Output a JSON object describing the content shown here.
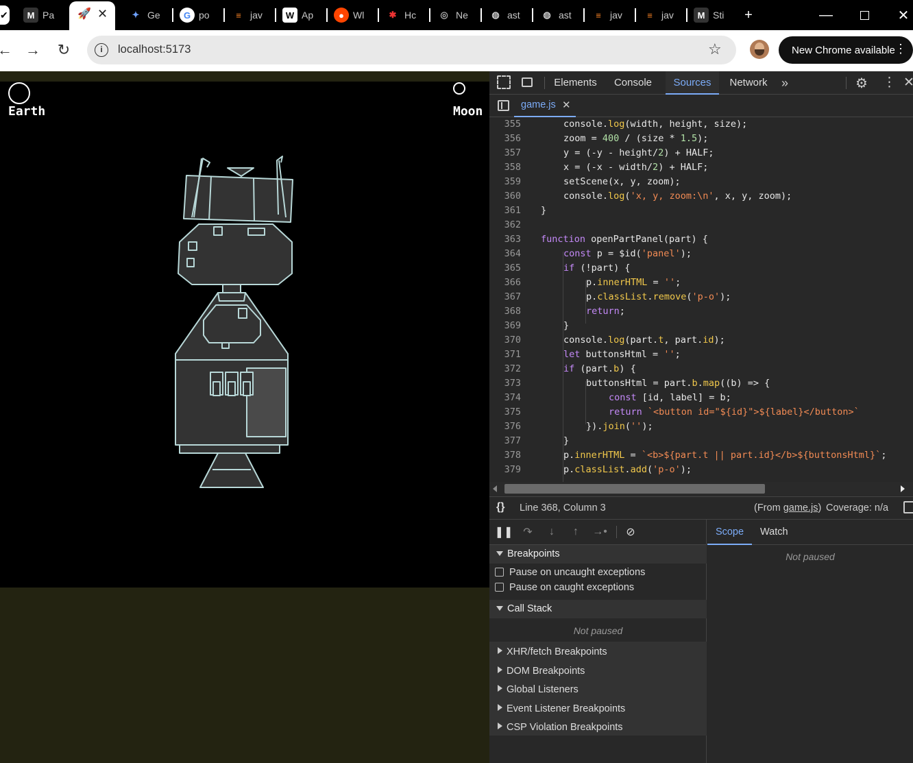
{
  "browser": {
    "tabs": [
      {
        "label": "Pa",
        "icon": "M"
      },
      {
        "label": "Ge",
        "icon": "✦"
      },
      {
        "label": "po",
        "icon": "G"
      },
      {
        "label": "jav",
        "icon": "≡"
      },
      {
        "label": "Ap",
        "icon": "W"
      },
      {
        "label": "Wl",
        "icon": "●"
      },
      {
        "label": "Hc",
        "icon": "✱"
      },
      {
        "label": "Ne",
        "icon": "◎"
      },
      {
        "label": "ast",
        "icon": "◍"
      },
      {
        "label": "ast",
        "icon": "◍"
      },
      {
        "label": "jav",
        "icon": "≡"
      },
      {
        "label": "jav",
        "icon": "≡"
      },
      {
        "label": "Sti",
        "icon": "M"
      }
    ],
    "active_tab_icon": "🚀",
    "new_tab": "+",
    "url": "localhost:5173",
    "update_button": "New Chrome available",
    "colors": {
      "accent": "#7cacf8",
      "tab_bar": "#000000"
    }
  },
  "game": {
    "earth_label": "Earth",
    "moon_label": "Moon",
    "ship_stroke": "#b8d8d8"
  },
  "devtools": {
    "tabs": [
      "Elements",
      "Console",
      "Sources",
      "Network"
    ],
    "active_tab": "Sources",
    "more_tabs": "»",
    "file_tab": "game.js",
    "code_lines": [
      {
        "n": "355",
        "t": "console.log(width, height, size);"
      },
      {
        "n": "356",
        "t": "zoom = 400 / (size * 1.5);"
      },
      {
        "n": "357",
        "t": "y = (-y - height/2) + HALF;"
      },
      {
        "n": "358",
        "t": "x = (-x - width/2) + HALF;"
      },
      {
        "n": "359",
        "t": "setScene(x, y, zoom);"
      },
      {
        "n": "360",
        "t": "console.log('x, y, zoom:\\n', x, y, zoom);"
      },
      {
        "n": "361",
        "t": "}"
      },
      {
        "n": "362",
        "t": ""
      },
      {
        "n": "363",
        "t": "function openPartPanel(part) {"
      },
      {
        "n": "364",
        "t": "const p = $id('panel');"
      },
      {
        "n": "365",
        "t": "if (!part) {"
      },
      {
        "n": "366",
        "t": "p.innerHTML = '';"
      },
      {
        "n": "367",
        "t": "p.classList.remove('p-o');"
      },
      {
        "n": "368",
        "t": "return;"
      },
      {
        "n": "369",
        "t": "}"
      },
      {
        "n": "370",
        "t": "console.log(part.t, part.id);"
      },
      {
        "n": "371",
        "t": "let buttonsHtml = '';"
      },
      {
        "n": "372",
        "t": "if (part.b) {"
      },
      {
        "n": "373",
        "t": "buttonsHtml = part.b.map((b) => {"
      },
      {
        "n": "374",
        "t": "const [id, label] = b;"
      },
      {
        "n": "375",
        "t": "return `<button id=\"${id}\">${label}</button>`"
      },
      {
        "n": "376",
        "t": "}).join('');"
      },
      {
        "n": "377",
        "t": "}"
      },
      {
        "n": "378",
        "t": "p.innerHTML = `<b>${part.t || part.id}</b>${buttonsHtml}`;"
      },
      {
        "n": "379",
        "t": "p.classList.add('p-o');"
      }
    ],
    "status_position": "Line 368, Column 3",
    "status_from_prefix": "(From ",
    "status_from_file": "game.js",
    "status_from_suffix": ")",
    "status_coverage": "Coverage: n/a",
    "breakpoints_header": "Breakpoints",
    "pause_uncaught": "Pause on uncaught exceptions",
    "pause_caught": "Pause on caught exceptions",
    "callstack_header": "Call Stack",
    "not_paused": "Not paused",
    "collapsed_sections": [
      "XHR/fetch Breakpoints",
      "DOM Breakpoints",
      "Global Listeners",
      "Event Listener Breakpoints",
      "CSP Violation Breakpoints"
    ],
    "scope_tab": "Scope",
    "watch_tab": "Watch",
    "scope_not_paused": "Not paused"
  }
}
